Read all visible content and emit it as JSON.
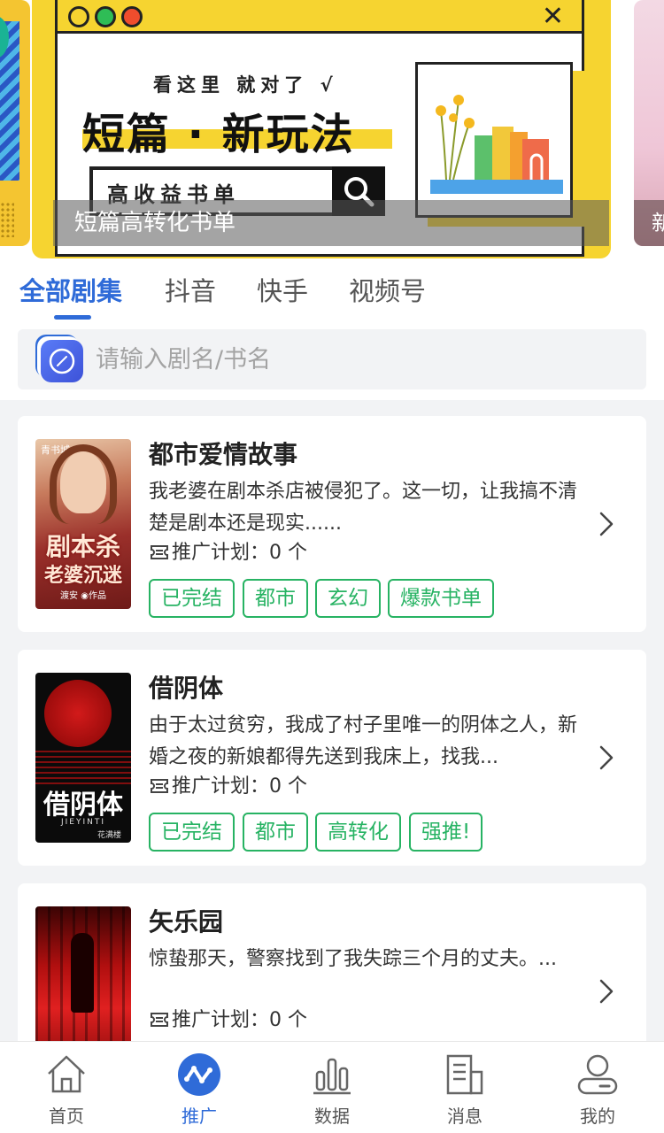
{
  "banner": {
    "tagline": "看这里 就对了 √",
    "headline": "短篇 · 新玩法",
    "search_text": "高收益书单",
    "caption": "短篇高转化书单",
    "right_peek_char": "新"
  },
  "tabs": [
    {
      "label": "全部剧集",
      "active": true
    },
    {
      "label": "抖音",
      "active": false
    },
    {
      "label": "快手",
      "active": false
    },
    {
      "label": "视频号",
      "active": false
    }
  ],
  "search": {
    "placeholder": "请输入剧名/书名"
  },
  "books": [
    {
      "title": "都市爱情故事",
      "desc": "我老婆在剧本杀店被侵犯了。这一切，让我搞不清楚是剧本还是现实......",
      "plan_label": "推广计划：",
      "plan_count": "0 个",
      "cover_text": "剧本杀",
      "cover_sub": "老婆沉迷",
      "cover_top": "青书城",
      "cover_author": "渡安 ◉作品",
      "tags": [
        "已完结",
        "都市",
        "玄幻",
        "爆款书单"
      ]
    },
    {
      "title": "借阴体",
      "desc": "由于太过贫穷，我成了村子里唯一的阴体之人，新婚之夜的新娘都得先送到我床上，找我...",
      "plan_label": "推广计划：",
      "plan_count": "0 个",
      "cover_text": "借阴体",
      "cover_sub": "JIEYINTI",
      "cover_author": "花满楼",
      "tags": [
        "已完结",
        "都市",
        "高转化",
        "强推!"
      ]
    },
    {
      "title": "矢乐园",
      "desc": "惊蛰那天，警察找到了我失踪三个月的丈夫。...",
      "plan_label": "推广计划：",
      "plan_count": "0 个",
      "tags": []
    }
  ],
  "nav": [
    {
      "label": "首页",
      "icon": "home-icon",
      "active": false
    },
    {
      "label": "推广",
      "icon": "promote-icon",
      "active": true
    },
    {
      "label": "数据",
      "icon": "chart-icon",
      "active": false
    },
    {
      "label": "消息",
      "icon": "message-icon",
      "active": false
    },
    {
      "label": "我的",
      "icon": "profile-icon",
      "active": false
    }
  ],
  "colors": {
    "accent": "#2f6bd8",
    "tag_green": "#27b363",
    "banner_yellow": "#f6d430"
  }
}
